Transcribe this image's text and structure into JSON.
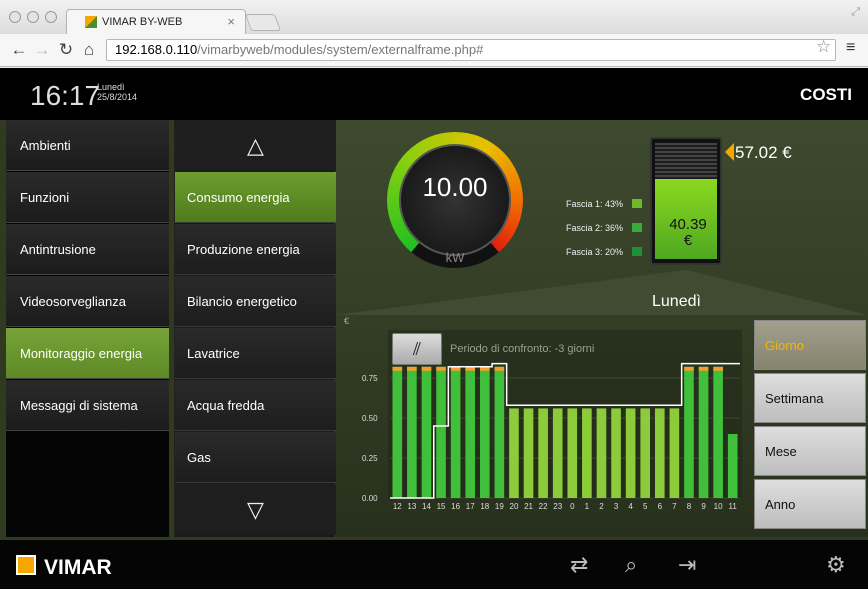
{
  "browser": {
    "tab_title": "VIMAR BY-WEB",
    "tab_close": "×",
    "url_host": "192.168.0.110",
    "url_path": "/vimarbyweb/modules/system/externalframe.php#"
  },
  "header": {
    "time": "16:17",
    "day": "Lunedì",
    "date": "25/8/2014",
    "section": "COSTI"
  },
  "sidebar": {
    "items": [
      {
        "label": "Ambienti"
      },
      {
        "label": "Funzioni"
      },
      {
        "label": "Antintrusione"
      },
      {
        "label": "Videosorveglianza"
      },
      {
        "label": "Monitoraggio energia"
      },
      {
        "label": "Messaggi di sistema"
      }
    ]
  },
  "submenu": {
    "items": [
      {
        "label": "Consumo energia"
      },
      {
        "label": "Produzione energia"
      },
      {
        "label": "Bilancio energetico"
      },
      {
        "label": "Lavatrice"
      },
      {
        "label": "Acqua fredda"
      },
      {
        "label": "Gas"
      }
    ]
  },
  "gauge": {
    "value": "10.00",
    "unit": "kW"
  },
  "fascia": [
    {
      "label": "Fascia 1: 43%",
      "color": "#6fb82a"
    },
    {
      "label": "Fascia 2: 36%",
      "color": "#3aa83a"
    },
    {
      "label": "Fascia 3: 20%",
      "color": "#1f8f3a"
    }
  ],
  "cost": {
    "current_line1": "40.39",
    "current_line2": "€",
    "max": "57.02 €"
  },
  "day_label": "Lunedì",
  "chart_data": {
    "type": "bar",
    "unit": "€",
    "compare_label": "Periodo di confronto: -3 giorni",
    "categories": [
      "12",
      "13",
      "14",
      "15",
      "16",
      "17",
      "18",
      "19",
      "20",
      "21",
      "22",
      "23",
      "0",
      "1",
      "2",
      "3",
      "4",
      "5",
      "6",
      "7",
      "8",
      "9",
      "10",
      "11"
    ],
    "values": [
      0.82,
      0.82,
      0.82,
      0.82,
      0.82,
      0.82,
      0.82,
      0.82,
      0.56,
      0.56,
      0.56,
      0.56,
      0.56,
      0.56,
      0.56,
      0.56,
      0.56,
      0.56,
      0.56,
      0.56,
      0.82,
      0.82,
      0.82,
      0.4
    ],
    "compare_values": [
      0.0,
      0.0,
      0.0,
      0.45,
      0.82,
      0.82,
      0.82,
      0.84,
      0.58,
      0.58,
      0.58,
      0.58,
      0.58,
      0.58,
      0.58,
      0.58,
      0.58,
      0.58,
      0.58,
      0.58,
      0.84,
      0.84,
      0.84,
      0.84
    ],
    "yticks": [
      "0.00",
      "0.25",
      "0.50",
      "0.75"
    ],
    "ylim": [
      0,
      1
    ],
    "colors": {
      "bar": "#3fbf3a",
      "bar_alt": "#8ccb3a",
      "top": "#f0a030",
      "compare": "#ffffff"
    }
  },
  "periods": [
    {
      "label": "Giorno",
      "active": true
    },
    {
      "label": "Settimana",
      "active": false
    },
    {
      "label": "Mese",
      "active": false
    },
    {
      "label": "Anno",
      "active": false
    }
  ],
  "footer": {
    "brand": "VIMAR"
  }
}
